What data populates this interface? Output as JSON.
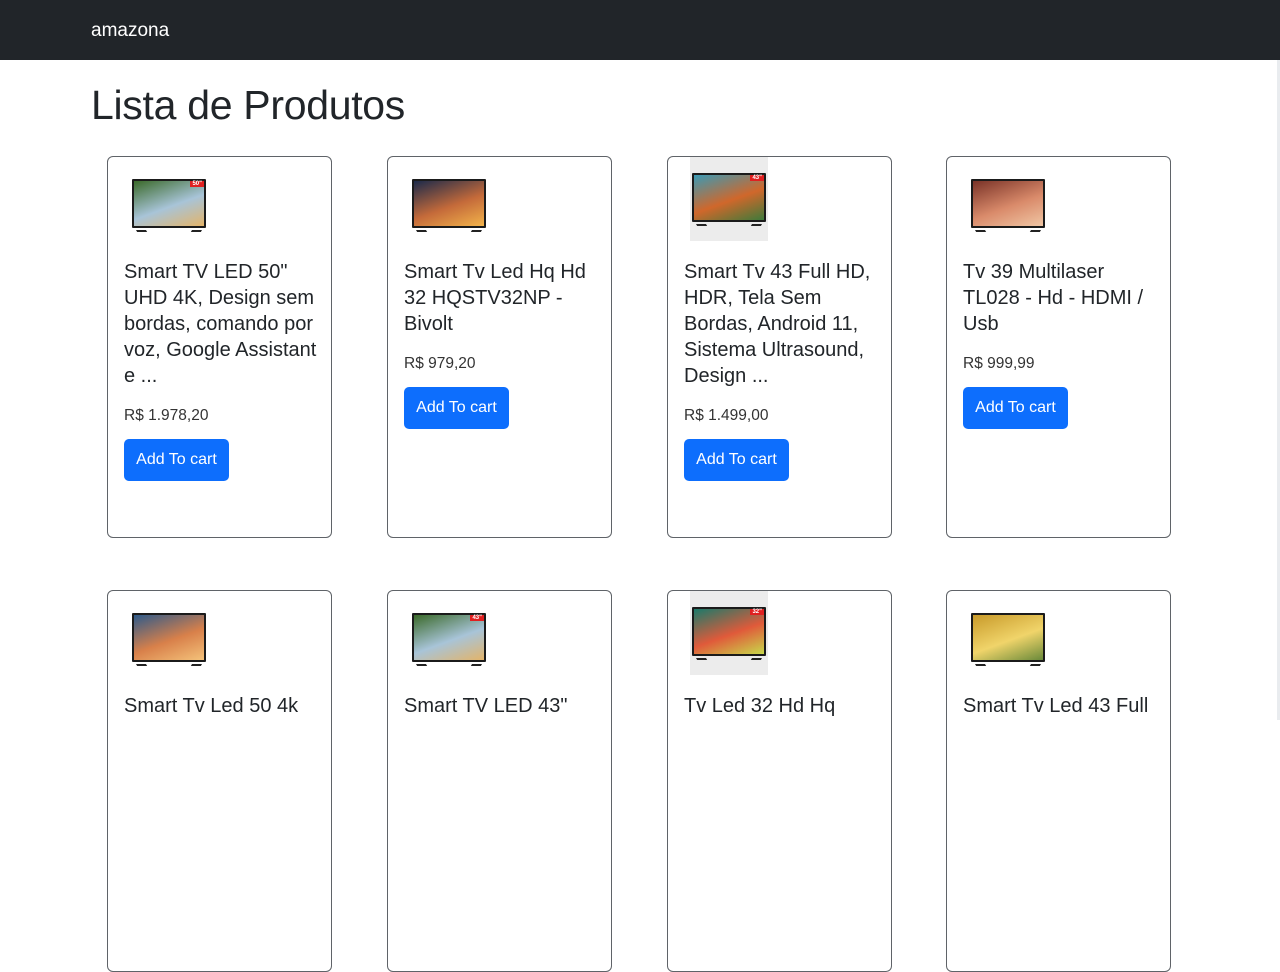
{
  "navbar": {
    "brand": "amazona"
  },
  "page": {
    "title": "Lista de Produtos"
  },
  "products": [
    {
      "name": "Smart TV LED 50\" UHD 4K, Design sem bordas, comando por voz, Google Assistant e ...",
      "price": "R$ 1.978,20",
      "button": "Add To cart",
      "badge": "50\"",
      "screen": [
        "#3b6a2a",
        "#a8c4d8",
        "#e3b46a"
      ]
    },
    {
      "name": "Smart Tv Led Hq Hd 32 HQSTV32NP - Bivolt",
      "price": "R$ 979,20",
      "button": "Add To cart",
      "badge": "",
      "screen": [
        "#1c2a4a",
        "#c46a3a",
        "#f2b34a"
      ]
    },
    {
      "name": "Smart Tv 43 Full HD, HDR, Tela Sem Bordas, Android 11, Sistema Ultrasound, Design ...",
      "price": "R$ 1.499,00",
      "button": "Add To cart",
      "badge": "43\"",
      "screen": [
        "#3a9ab5",
        "#d0672b",
        "#3e7a3a"
      ]
    },
    {
      "name": "Tv 39 Multilaser TL028 - Hd - HDMI / Usb",
      "price": "R$ 999,99",
      "button": "Add To cart",
      "badge": "",
      "screen": [
        "#7a3328",
        "#d98a6a",
        "#f0c6a4"
      ]
    },
    {
      "name": "Smart Tv Led 50 4k",
      "price": "",
      "button": "",
      "badge": "",
      "screen": [
        "#2e5a8a",
        "#d8804a",
        "#f4c27a"
      ]
    },
    {
      "name": "Smart TV LED 43\"",
      "price": "",
      "button": "",
      "badge": "43\"",
      "screen": [
        "#3b6a2a",
        "#a8c4d8",
        "#e3b46a"
      ]
    },
    {
      "name": "Tv Led 32 Hd Hq",
      "price": "",
      "button": "",
      "badge": "32\"",
      "screen": [
        "#1a7a6a",
        "#e05a3a",
        "#c8d84a"
      ]
    },
    {
      "name": "Smart Tv Led 43 Full",
      "price": "",
      "button": "",
      "badge": "",
      "screen": [
        "#c89a2a",
        "#f0d46a",
        "#6a8a3a"
      ]
    }
  ]
}
